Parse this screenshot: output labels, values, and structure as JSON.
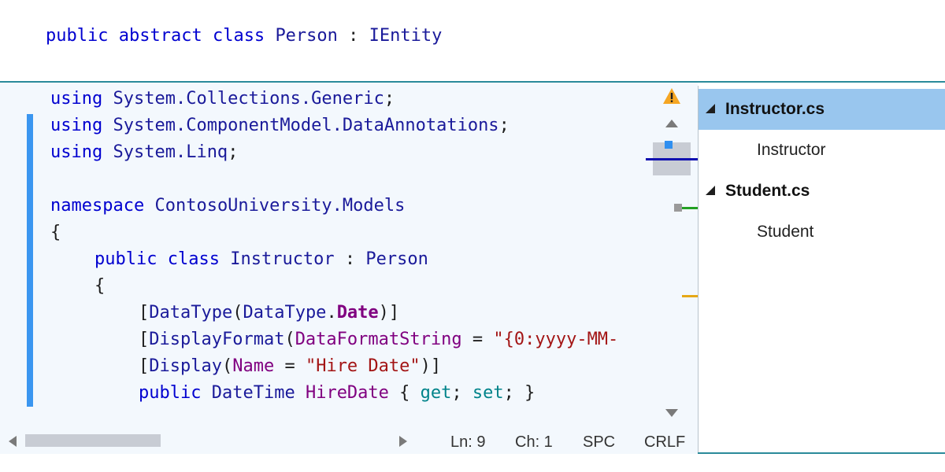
{
  "header": {
    "kw_public": "public",
    "kw_abstract": "abstract",
    "kw_class": "class",
    "class_name": "Person",
    "colon": ":",
    "interface": "IEntity"
  },
  "code": {
    "line1": {
      "kw": "using",
      "ns": "System.Collections.Generic",
      "end": ";"
    },
    "line2": {
      "kw": "using",
      "ns": "System.ComponentModel.DataAnnotations",
      "end": ";"
    },
    "line3": {
      "kw": "using",
      "ns": "System.Linq",
      "end": ";"
    },
    "line5": {
      "kw": "namespace",
      "ns": "ContosoUniversity.Models"
    },
    "line6": {
      "brace": "{"
    },
    "line7": {
      "kw_public": "public",
      "kw_class": "class",
      "name": "Instructor",
      "colon": ":",
      "base": "Person"
    },
    "line8": {
      "brace": "{"
    },
    "line9": {
      "open": "[",
      "attr": "DataType",
      "paren": "(",
      "arg_type": "DataType",
      "dot": ".",
      "member": "Date",
      "close": ")]"
    },
    "line10": {
      "open": "[",
      "attr": "DisplayFormat",
      "paren": "(",
      "param": "DataFormatString",
      "eq": " = ",
      "value": "\"{0:yyyy-MM-"
    },
    "line11": {
      "open": "[",
      "attr": "Display",
      "paren": "(",
      "param": "Name",
      "eq": " = ",
      "value": "\"Hire Date\"",
      "close": ")]"
    },
    "line12": {
      "kw_public": "public",
      "type": "DateTime",
      "name": "HireDate",
      "open": " { ",
      "get": "get",
      "semi1": "; ",
      "set": "set",
      "semi2": "; }"
    }
  },
  "status": {
    "line": "Ln: 9",
    "col": "Ch: 1",
    "whitespace": "SPC",
    "line_ending": "CRLF"
  },
  "outline": {
    "items": [
      {
        "file": "Instructor.cs",
        "class": "Instructor",
        "selected": true
      },
      {
        "file": "Student.cs",
        "class": "Student",
        "selected": false
      }
    ]
  },
  "icons": {
    "warning": "warning-icon",
    "scroll_up": "triangle-up-icon",
    "scroll_down": "triangle-down-icon",
    "scroll_left": "triangle-left-icon",
    "scroll_right": "triangle-right-icon",
    "expand": "expanded-triangle-icon"
  },
  "colors": {
    "keyword": "#0000d0",
    "type": "#1a1a9a",
    "string": "#a31515",
    "property": "#800080",
    "accessor": "#00838a",
    "selection": "#99c6ee",
    "change_bar": "#3a96f0",
    "warning": "#f5a623"
  }
}
